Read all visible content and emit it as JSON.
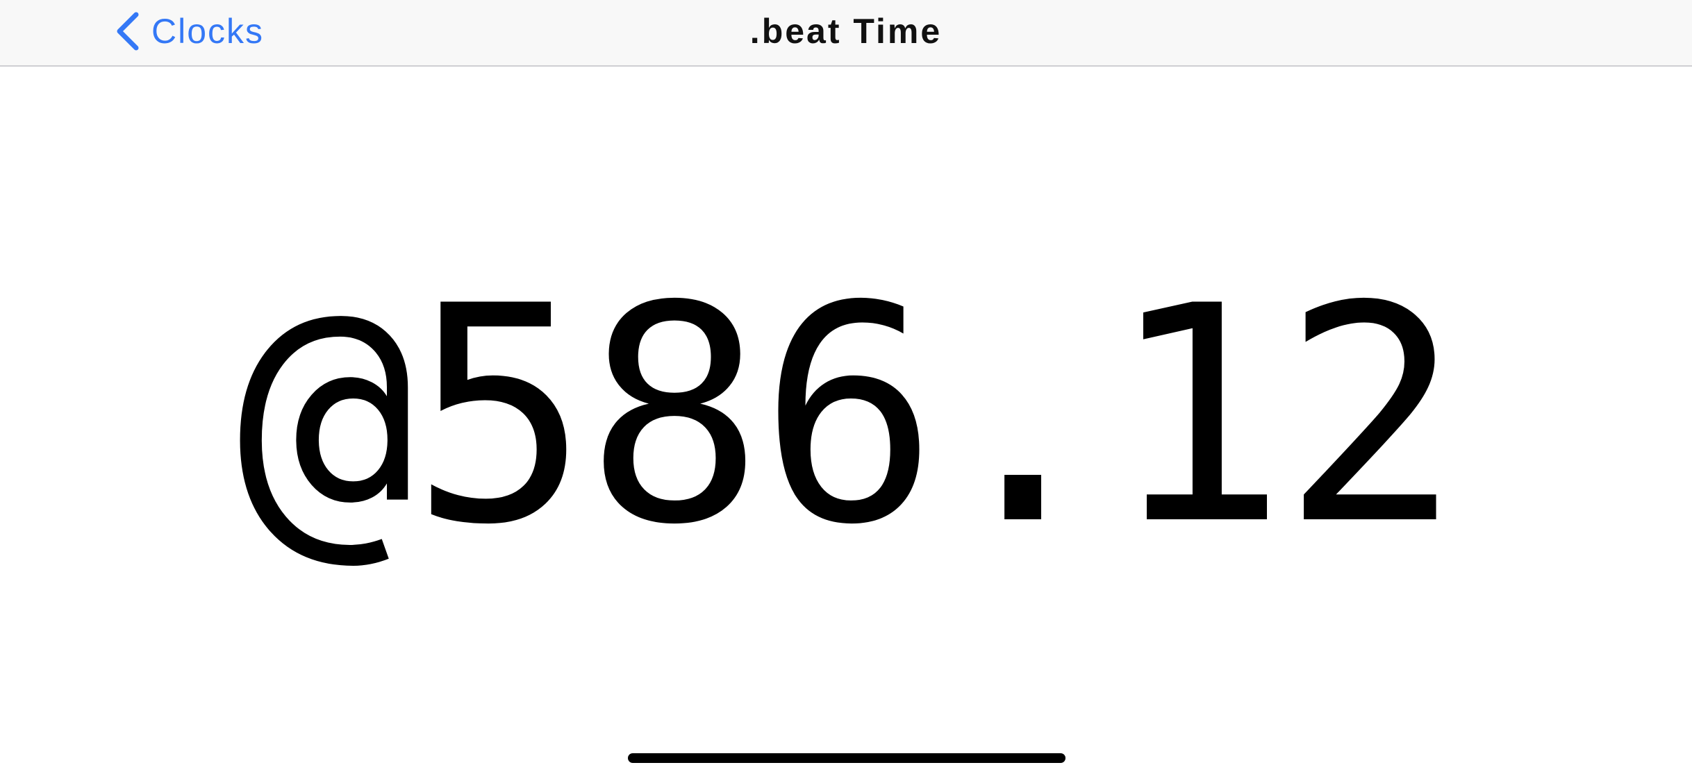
{
  "navbar": {
    "back_label": "Clocks",
    "title": ".beat Time",
    "accent_color": "#3478f6"
  },
  "clock": {
    "beat_time": "@586.12"
  },
  "icons": {
    "back": "chevron-left-icon"
  }
}
